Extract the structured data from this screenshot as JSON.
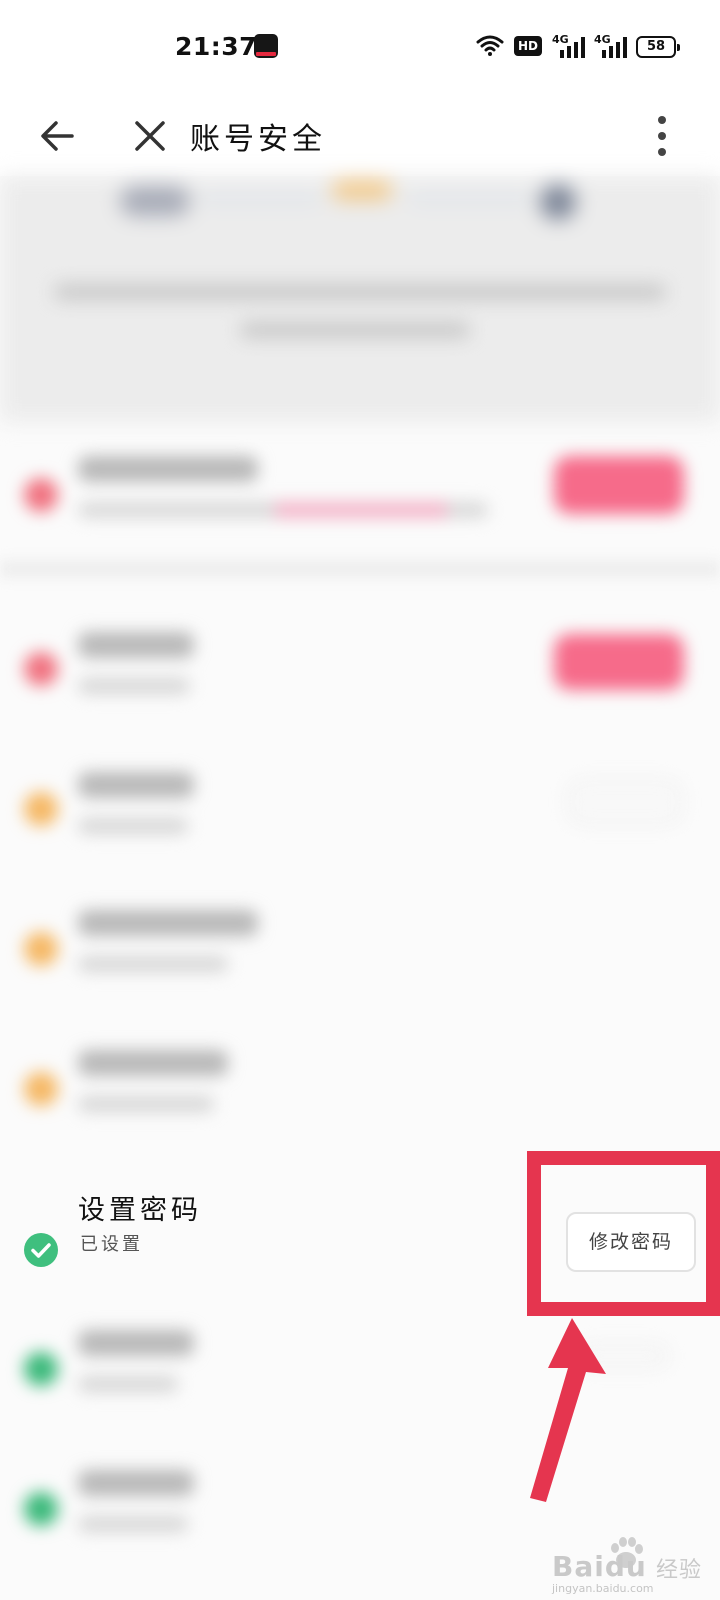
{
  "status_bar": {
    "time": "21:37",
    "hd_label": "HD",
    "network_1": "4G",
    "network_2": "4G",
    "battery": "58",
    "icons": [
      "tiktok-notification-icon",
      "wifi-icon",
      "hd-icon",
      "signal-icon",
      "signal-icon",
      "battery-icon"
    ]
  },
  "title_bar": {
    "title": "账号安全",
    "icons": [
      "back-arrow-icon",
      "close-icon",
      "more-vertical-icon"
    ]
  },
  "security_items": [
    {
      "status": "warning",
      "color": "#f0717f",
      "action": "pink-button"
    },
    {
      "status": "warning",
      "color": "#f0717f",
      "action": "pink-button"
    },
    {
      "status": "caution",
      "color": "#f5b763",
      "action": "outline-button"
    },
    {
      "status": "caution",
      "color": "#f5b763",
      "action": "none"
    },
    {
      "status": "caution",
      "color": "#f5b763",
      "action": "none"
    },
    {
      "status": "ok",
      "color": "#39b879",
      "action": "outline-button"
    },
    {
      "status": "ok",
      "color": "#39b879",
      "action": "none"
    }
  ],
  "password_item": {
    "title": "设置密码",
    "subtitle": "已设置",
    "button_label": "修改密码",
    "status_icon": "check-circle-icon",
    "status_color": "#3fbf7e"
  },
  "annotation": {
    "highlight_color": "#e5354f",
    "arrow_color": "#e5354f"
  },
  "watermark": {
    "brand": "Baidu",
    "suffix": "经验",
    "url": "jingyan.baidu.com"
  }
}
